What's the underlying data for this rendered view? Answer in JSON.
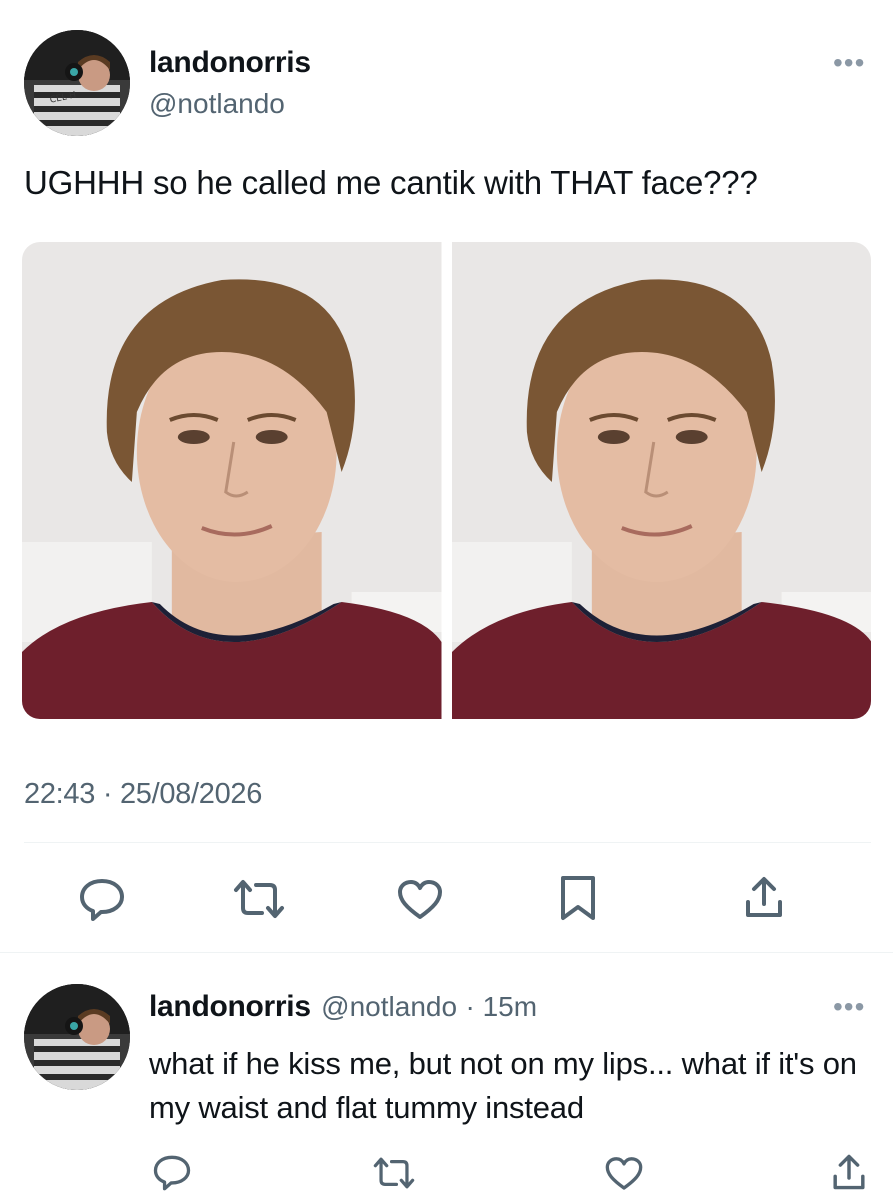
{
  "tweet": {
    "display_name": "landonorris",
    "handle": "@notlando",
    "more_label": "•••",
    "text": "UGHHH so he called me cantik with THAT face???",
    "timestamp": "22:43 · 25/08/2026",
    "avatar_caption": "CEL H",
    "photos": [
      {
        "name": "photo-left"
      },
      {
        "name": "photo-right"
      }
    ],
    "actions": {
      "reply": "reply-icon",
      "retweet": "retweet-icon",
      "like": "heart-icon",
      "bookmark": "bookmark-icon",
      "share": "share-icon"
    }
  },
  "reply": {
    "display_name": "landonorris",
    "handle": "@notlando",
    "time": "· 15m",
    "more_label": "•••",
    "text": "what if he kiss me, but not on my lips... what if it's on my waist and flat tummy instead",
    "actions": {
      "reply": "reply-icon",
      "retweet": "retweet-icon",
      "like": "heart-icon",
      "share": "share-icon"
    }
  },
  "colors": {
    "text": "#0f1419",
    "secondary": "#536471",
    "divider": "#eff3f4",
    "shirt": "#6e1f2c"
  }
}
